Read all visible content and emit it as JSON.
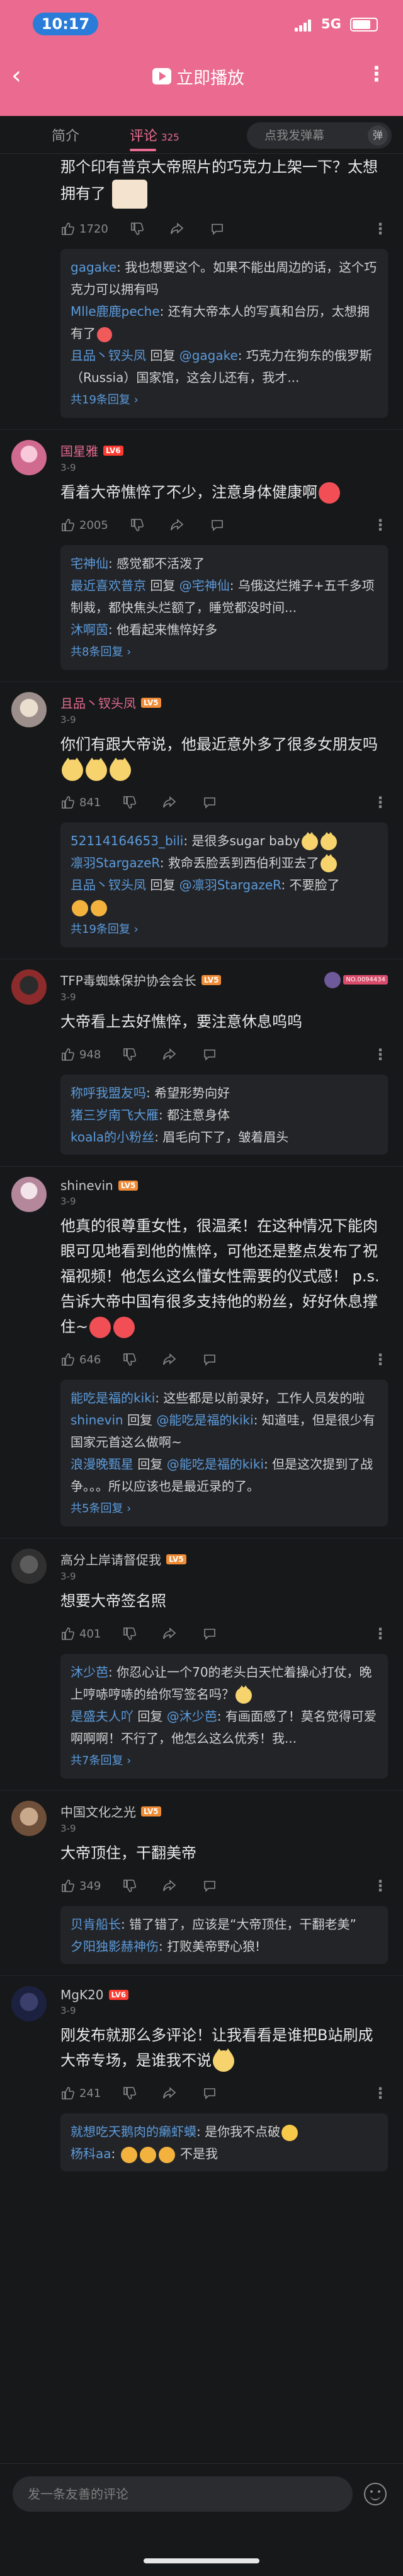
{
  "status": {
    "time": "10:17",
    "network": "5G"
  },
  "nav": {
    "back": "‹",
    "play_label": "立即播放",
    "more": "⋮"
  },
  "tabs": {
    "intro": "简介",
    "comments": "评论",
    "count": "325",
    "danmaku_placeholder": "点我发弹幕",
    "danmaku_btn": "弹"
  },
  "comments": [
    {
      "name": "",
      "date": "",
      "text": "那个印有普京大帝照片的巧克力上架一下？太想拥有了",
      "likes": "1720",
      "replies": [
        {
          "name": "gagake",
          "text": "我也想要这个。如果不能出周边的话，这个巧克力可以拥有吗"
        },
        {
          "name": "Mlle鹿鹿peche",
          "text": "还有大帝本人的写真和台历，太想拥有了"
        },
        {
          "name": "且品丶钗头凤",
          "op": "回复",
          "at": "@gagake",
          "text": "巧克力在狗东的俄罗斯（Russia）国家馆，这会儿还有，我才..."
        }
      ],
      "more": "共19条回复 ›"
    },
    {
      "name": "国星雅",
      "date": "3-9",
      "text": "看着大帝憔悴了不少，注意身体健康啊",
      "likes": "2005",
      "replies": [
        {
          "name": "宅神仙",
          "text": "感觉都不活泼了"
        },
        {
          "name": "最近喜欢普京",
          "op": "回复",
          "at": "@宅神仙",
          "text": "乌俄这烂摊子+五千多项制裁，都快焦头烂额了，睡觉都没时间..."
        },
        {
          "name": "沐啊茵",
          "text": "他看起来憔悴好多"
        }
      ],
      "more": "共8条回复 ›"
    },
    {
      "name": "且品丶钗头凤",
      "date": "3-9",
      "text": "你们有跟大帝说，他最近意外多了很多女朋友吗",
      "likes": "841",
      "replies": [
        {
          "name": "52114164653_bili",
          "text": "是很多sugar baby"
        },
        {
          "name": "凛羽StargazeR",
          "text": "救命丢脸丢到西伯利亚去了"
        },
        {
          "name": "且品丶钗头凤",
          "op": "回复",
          "at": "@凛羽StargazeR",
          "text": "不要脸了"
        }
      ],
      "more": "共19条回复 ›"
    },
    {
      "name": "TFP毒蜘蛛保护协会会长",
      "date": "3-9",
      "text": "大帝看上去好憔悴，要注意休息呜呜",
      "likes": "948",
      "replies": [
        {
          "name": "称呼我盟友吗",
          "text": "希望形势向好"
        },
        {
          "name": "猪三岁南飞大雁",
          "text": "都注意身体"
        },
        {
          "name": "koala的小粉丝",
          "text": "眉毛向下了，皱着眉头"
        }
      ],
      "more": ""
    },
    {
      "name": "shinevin",
      "date": "3-9",
      "text": "他真的很尊重女性，很温柔！在这种情况下能肉眼可见地看到他的憔悴，可他还是整点发布了祝福视频！他怎么这么懂女性需要的仪式感！ p.s.告诉大帝中国有很多支持他的粉丝，好好休息撑住~",
      "likes": "646",
      "replies": [
        {
          "name": "能吃是福的kiki",
          "text": "这些都是以前录好，工作人员发的啦"
        },
        {
          "name": "shinevin",
          "op": "回复",
          "at": "@能吃是福的kiki",
          "text": "知道哇，但是很少有国家元首这么做啊~"
        },
        {
          "name": "浪漫晚甄星",
          "op": "回复",
          "at": "@能吃是福的kiki",
          "text": "但是这次提到了战争。。。所以应该也是最近录的了。"
        }
      ],
      "more": "共5条回复 ›"
    },
    {
      "name": "高分上岸请督促我",
      "date": "3-9",
      "text": "想要大帝签名照",
      "likes": "401",
      "replies": [
        {
          "name": "沐少芭",
          "text": "你忍心让一个70的老头白天忙着操心打仗，晚上哼哧哼哧的给你写签名吗？"
        },
        {
          "name": "是盛夫人吖",
          "op": "回复",
          "at": "@沐少芭",
          "text": "有画面感了！莫名觉得可爱啊啊啊！不行了，他怎么这么优秀！我..."
        }
      ],
      "more": "共7条回复 ›"
    },
    {
      "name": "中国文化之光",
      "date": "3-9",
      "text": "大帝顶住，干翻美帝",
      "likes": "349",
      "replies": [
        {
          "name": "贝肯船长",
          "text": "错了错了，应该是“大帝顶住，干翻老美”"
        },
        {
          "name": "夕阳独影赫神伤",
          "text": "打败美帝野心狼!"
        }
      ],
      "more": ""
    },
    {
      "name": "MgK20",
      "date": "3-9",
      "text": "刚发布就那么多评论！让我看看是谁把B站刷成大帝专场，是谁我不说",
      "likes": "241",
      "replies": [
        {
          "name": "就想吃天鹅肉的癞虾蟆",
          "text": "是你我不点破"
        },
        {
          "name": "杨科aa",
          "text": "不是我"
        }
      ],
      "more": ""
    }
  ],
  "levels": [
    "LV6",
    "LV5",
    "LV5",
    "LV5",
    "LV5",
    "LV5",
    "LV6"
  ],
  "medal_label": "NO.0094434",
  "bottom": {
    "input_placeholder": "发一条友善的评论"
  }
}
